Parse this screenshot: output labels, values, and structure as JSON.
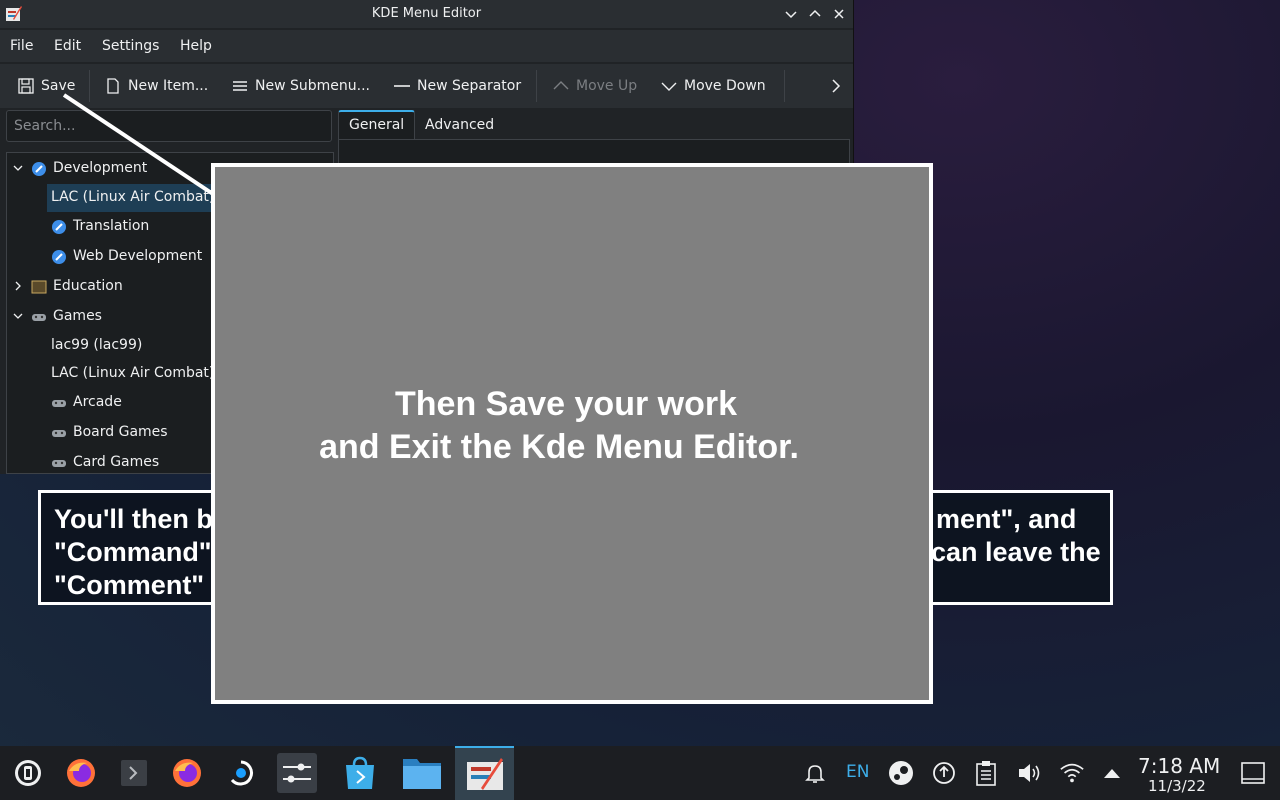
{
  "window": {
    "title": "KDE Menu Editor",
    "app_icon": "kde-menu-editor-icon",
    "controls": [
      "minimize-icon",
      "maximize-icon",
      "close-icon"
    ]
  },
  "menubar": [
    "File",
    "Edit",
    "Settings",
    "Help"
  ],
  "toolbar": {
    "save": "Save",
    "new_item": "New Item...",
    "new_submenu": "New Submenu...",
    "new_separator": "New Separator",
    "move_up": "Move Up",
    "move_down": "Move Down",
    "more": "chevron-right-icon"
  },
  "search": {
    "placeholder": "Search..."
  },
  "tree": [
    {
      "label": "Development",
      "icon": "development-icon",
      "expanded": true,
      "level": 0
    },
    {
      "label": "LAC (Linux Air Combat)",
      "icon": "",
      "level": 1,
      "selected": true
    },
    {
      "label": "Translation",
      "icon": "development-icon",
      "level": 1
    },
    {
      "label": "Web Development",
      "icon": "development-icon",
      "level": 1
    },
    {
      "label": "Education",
      "icon": "education-icon",
      "expanded": false,
      "level": 0
    },
    {
      "label": "Games",
      "icon": "gamepad-icon",
      "expanded": true,
      "level": 0
    },
    {
      "label": "lac99 (lac99)",
      "icon": "",
      "level": 1
    },
    {
      "label": "LAC (Linux Air Combat)",
      "icon": "",
      "level": 1
    },
    {
      "label": "Arcade",
      "icon": "gamepad-icon",
      "level": 1
    },
    {
      "label": "Board Games",
      "icon": "gamepad-icon",
      "level": 1
    },
    {
      "label": "Card Games",
      "icon": "gamepad-icon",
      "level": 1
    }
  ],
  "tabs": [
    {
      "label": "General",
      "active": true
    },
    {
      "label": "Advanced",
      "active": false
    }
  ],
  "caption": {
    "left_line1": "You'll then b",
    "left_line2": "\"Command\"",
    "left_line3": "\"Comment\" -",
    "right_line1": "ment\", and",
    "right_line2": "can leave the"
  },
  "overlay": {
    "line1": "Then Save your work",
    "line2": "and Exit the Kde Menu Editor."
  },
  "taskbar": {
    "apps": [
      "application-launcher-icon",
      "firefox-icon",
      "terminal-icon",
      "firefox-icon",
      "steam-icon",
      "system-settings-icon",
      "discover-icon",
      "file-manager-icon",
      "kde-menu-editor-icon"
    ],
    "tray": {
      "notifications": "bell-icon",
      "keyboard_layout": "EN",
      "steam": "steam-tray-icon",
      "updates": "update-icon",
      "clipboard": "clipboard-icon",
      "volume": "volume-icon",
      "wifi": "wifi-icon",
      "expand": "arrow-up-icon"
    },
    "time": "7:18 AM",
    "date": "11/3/22",
    "show_desktop": "show-desktop-icon"
  },
  "colors": {
    "accent": "#3daee9",
    "window_bg": "#202326",
    "overlay_gray": "#808080",
    "selection": "#1e3e55"
  }
}
